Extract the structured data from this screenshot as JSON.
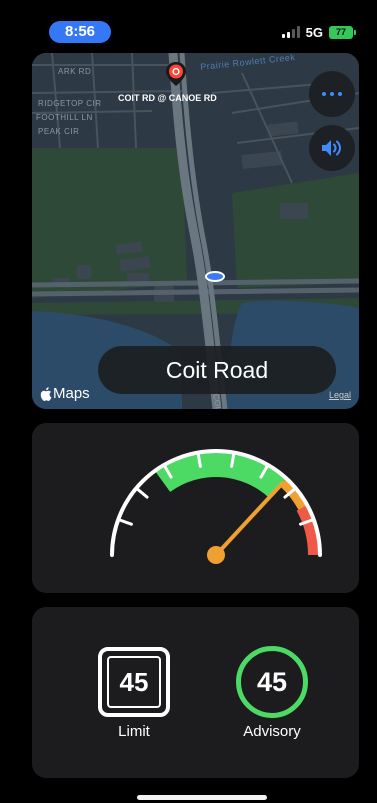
{
  "status_bar": {
    "time": "8:56",
    "network": "5G",
    "battery": "77"
  },
  "map": {
    "street_labels": [
      "ARK RD",
      "RIDGETOP CIR",
      "FOOTHILL LN",
      "PEAK CIR",
      "Prairie Rowlett Creek",
      "COIT RD"
    ],
    "destination_label": "COIT RD @ CANOE RD",
    "road_name": "Coit Road",
    "brand": "Maps",
    "legal": "Legal",
    "colors": {
      "land": "#2e3a44",
      "park": "#2f4a37",
      "water": "#2c4c6b",
      "road": "#5b6770",
      "location": "#3a7cf0"
    }
  },
  "icons": {
    "more": "ellipsis-icon",
    "sound": "speaker-icon",
    "pin": "map-pin-icon",
    "apple": "apple-logo-icon"
  },
  "gauge": {
    "speed": 45,
    "speed_limit": 45,
    "colors": {
      "ok": "#4cd964",
      "warn": "#f0a030",
      "over": "#ee5a47",
      "needle": "#f0a030"
    }
  },
  "limits": {
    "limit_value": "45",
    "limit_label": "Limit",
    "advisory_value": "45",
    "advisory_label": "Advisory",
    "advisory_color": "#4cd964"
  }
}
